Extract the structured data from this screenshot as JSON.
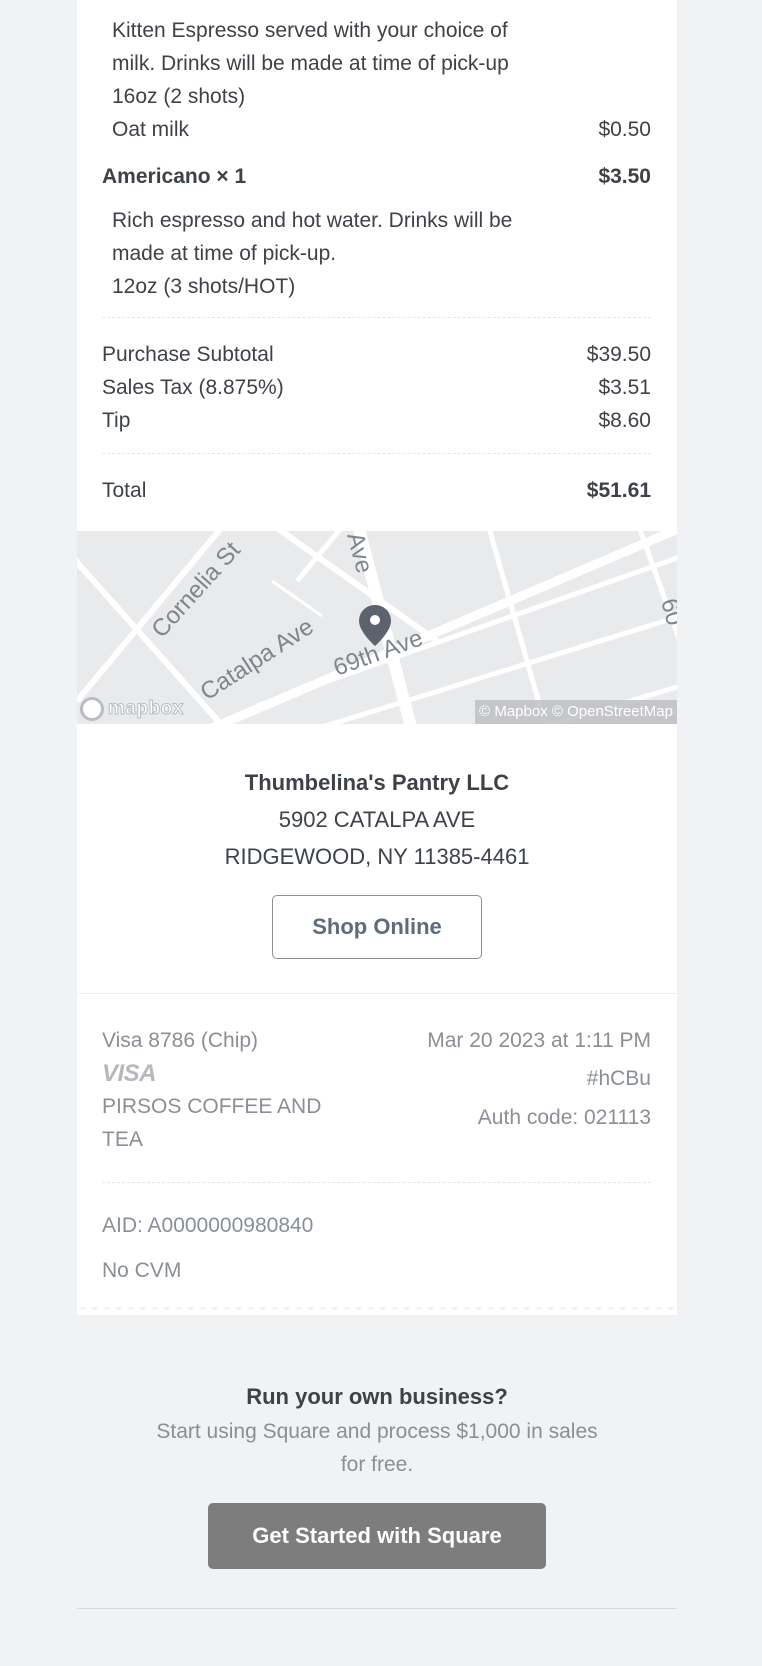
{
  "items": [
    {
      "description_lines": [
        "Kitten Espresso served with your choice of",
        "milk. Drinks will be made at time of pick-up"
      ],
      "modifiers": [
        {
          "label": "16oz (2 shots)",
          "price": ""
        },
        {
          "label": "Oat milk",
          "price": "$0.50"
        }
      ]
    },
    {
      "name": "Americano × 1",
      "price": "$3.50",
      "description_lines": [
        "Rich espresso and hot water. Drinks will be",
        "made at time of pick-up."
      ],
      "modifiers": [
        {
          "label": "12oz (3 shots/HOT)",
          "price": ""
        }
      ]
    }
  ],
  "totals": {
    "subtotal_label": "Purchase Subtotal",
    "subtotal": "$39.50",
    "tax_label": "Sales Tax (8.875%)",
    "tax": "$3.51",
    "tip_label": "Tip",
    "tip": "$8.60",
    "total_label": "Total",
    "total": "$51.61"
  },
  "map": {
    "streets": [
      "Cornelia St",
      "Catalpa Ave",
      "69th Ave",
      "Ave",
      "60"
    ],
    "logo_text": "mapbox",
    "attribution": "© Mapbox © OpenStreetMap"
  },
  "merchant": {
    "name": "Thumbelina's Pantry LLC",
    "address_line1": "5902 CATALPA AVE",
    "address_line2": "RIDGEWOOD, NY 11385-4461",
    "shop_button": "Shop Online"
  },
  "payment": {
    "card": "Visa 8786 (Chip)",
    "card_brand": "VISA",
    "merchant_descriptor": "PIRSOS COFFEE AND TEA",
    "datetime": "Mar 20 2023 at 1:11 PM",
    "receipt_code": "#hCBu",
    "auth_code": "Auth code: 021113",
    "aid": "AID: A0000000980840",
    "cvm": "No CVM"
  },
  "promo": {
    "title": "Run your own business?",
    "text": "Start using Square and process $1,000 in sales for free.",
    "button": "Get Started with Square"
  },
  "colors": {
    "background": "#f1f2f4",
    "text": "#3d4249",
    "muted": "#8a8f96",
    "button_gray": "#7d7d7d"
  }
}
